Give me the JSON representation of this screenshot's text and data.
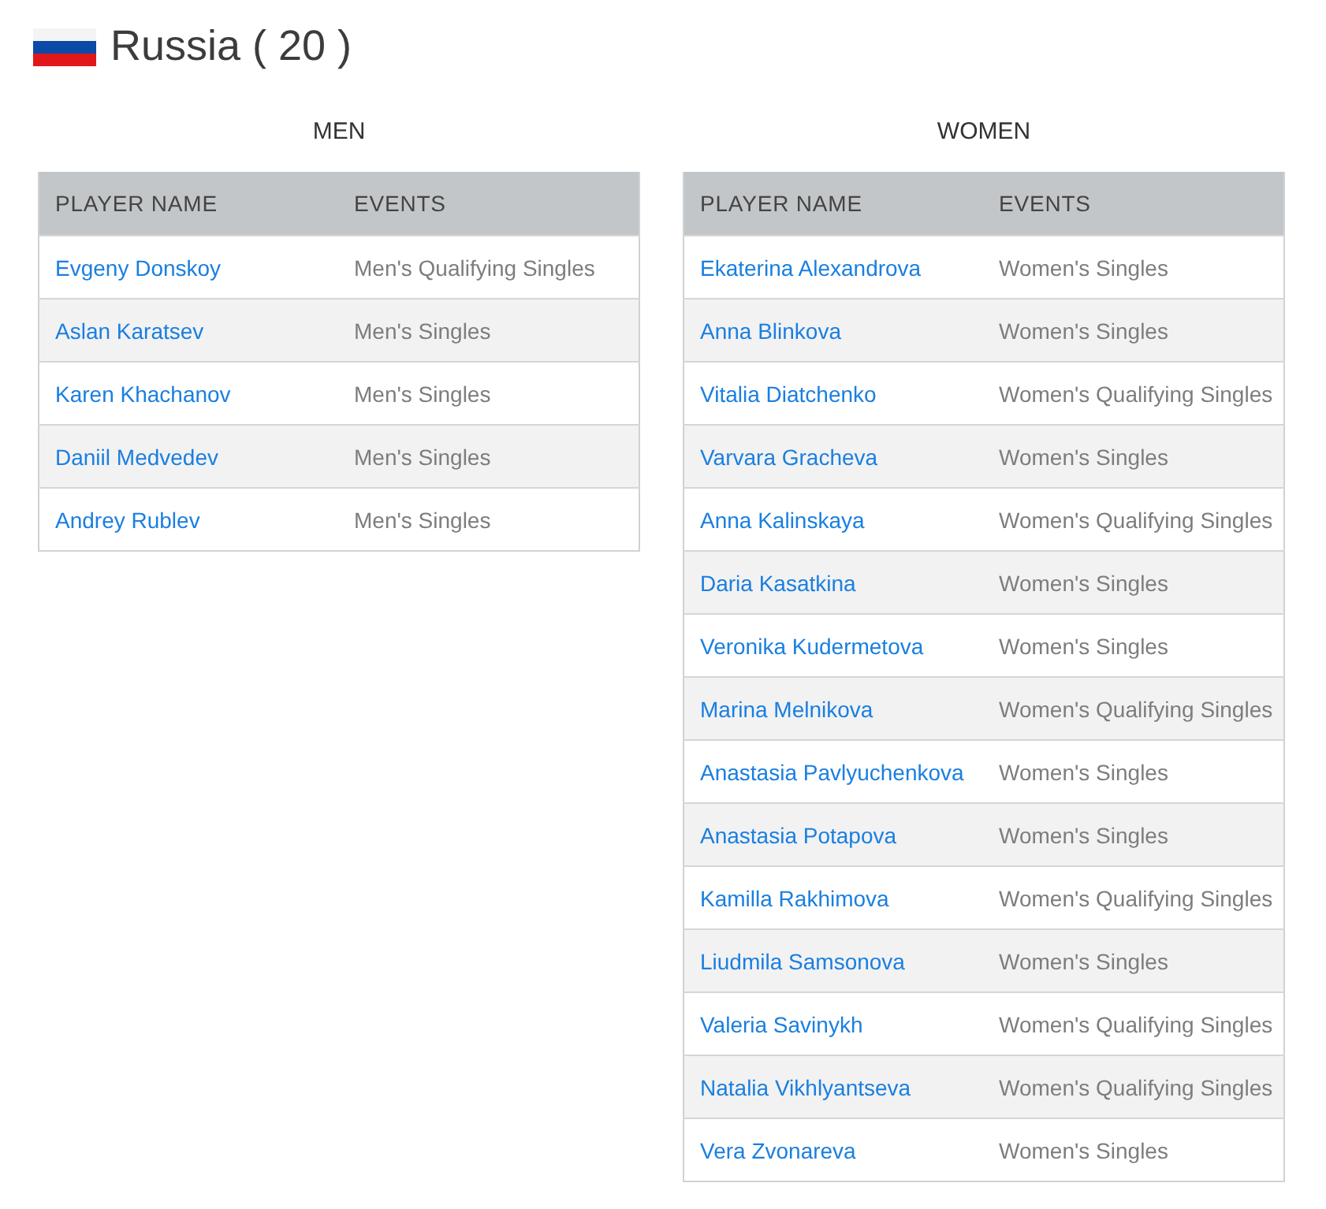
{
  "title": "Russia ( 20 )",
  "sections": [
    {
      "heading": "MEN",
      "columns": [
        "PLAYER NAME",
        "EVENTS"
      ],
      "rows": [
        {
          "player": "Evgeny Donskoy",
          "events": "Men's Qualifying Singles"
        },
        {
          "player": "Aslan Karatsev",
          "events": "Men's Singles"
        },
        {
          "player": "Karen Khachanov",
          "events": "Men's Singles"
        },
        {
          "player": "Daniil Medvedev",
          "events": "Men's Singles"
        },
        {
          "player": "Andrey Rublev",
          "events": "Men's Singles"
        }
      ]
    },
    {
      "heading": "WOMEN",
      "columns": [
        "PLAYER NAME",
        "EVENTS"
      ],
      "rows": [
        {
          "player": "Ekaterina Alexandrova",
          "events": "Women's Singles"
        },
        {
          "player": "Anna Blinkova",
          "events": "Women's Singles"
        },
        {
          "player": "Vitalia Diatchenko",
          "events": "Women's Qualifying Singles"
        },
        {
          "player": "Varvara Gracheva",
          "events": "Women's Singles"
        },
        {
          "player": "Anna Kalinskaya",
          "events": "Women's Qualifying Singles"
        },
        {
          "player": "Daria Kasatkina",
          "events": "Women's Singles"
        },
        {
          "player": "Veronika Kudermetova",
          "events": "Women's Singles"
        },
        {
          "player": "Marina Melnikova",
          "events": "Women's Qualifying Singles"
        },
        {
          "player": "Anastasia Pavlyuchenkova",
          "events": "Women's Singles"
        },
        {
          "player": "Anastasia Potapova",
          "events": "Women's Singles"
        },
        {
          "player": "Kamilla Rakhimova",
          "events": "Women's Qualifying Singles"
        },
        {
          "player": "Liudmila Samsonova",
          "events": "Women's Singles"
        },
        {
          "player": "Valeria Savinykh",
          "events": "Women's Qualifying Singles"
        },
        {
          "player": "Natalia Vikhlyantseva",
          "events": "Women's Qualifying Singles"
        },
        {
          "player": "Vera Zvonareva",
          "events": "Women's Singles"
        }
      ]
    }
  ]
}
